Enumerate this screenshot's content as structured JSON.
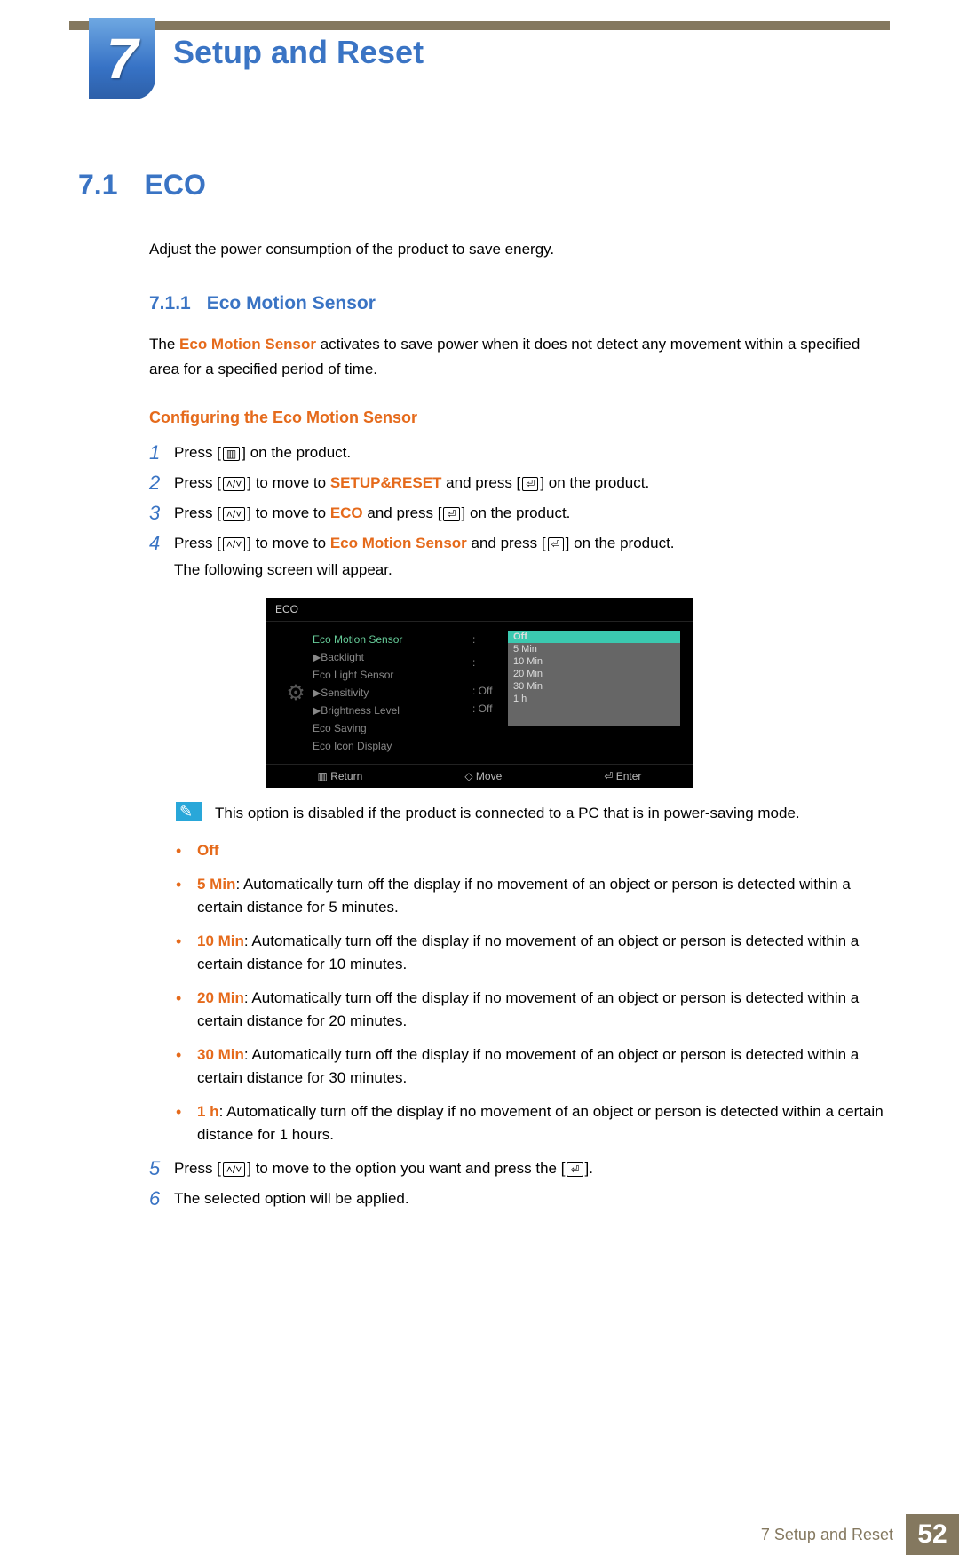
{
  "chapter": {
    "number": "7",
    "title": "Setup and Reset"
  },
  "section": {
    "number": "7.1",
    "title": "ECO",
    "intro": "Adjust the power consumption of the product to save energy."
  },
  "subsection": {
    "number": "7.1.1",
    "title": "Eco Motion Sensor",
    "desc_prefix": "The ",
    "desc_highlight": "Eco Motion Sensor",
    "desc_suffix": " activates to save power when it does not detect any movement within a specified area for a specified period of time."
  },
  "config_heading": "Configuring the Eco Motion Sensor",
  "steps": {
    "s1": {
      "n": "1",
      "a": "Press [",
      "b": "] on the product."
    },
    "s2": {
      "n": "2",
      "a": "Press [",
      "b": "] to move to ",
      "kw": "SETUP&RESET",
      "c": " and press [",
      "d": "] on the product."
    },
    "s3": {
      "n": "3",
      "a": "Press [",
      "b": "] to move to ",
      "kw": "ECO",
      "c": " and press [",
      "d": "] on the product."
    },
    "s4": {
      "n": "4",
      "a": "Press [",
      "b": "] to move to ",
      "kw": "Eco Motion Sensor",
      "c": " and press [",
      "d": "] on the product.",
      "e": "The following screen will appear."
    },
    "s5": {
      "n": "5",
      "a": "Press [",
      "b": "] to move to the option you want and press the [",
      "c": "]."
    },
    "s6": {
      "n": "6",
      "a": "The selected option will be applied."
    }
  },
  "osd": {
    "title": "ECO",
    "items": [
      "Eco Motion Sensor",
      "▶Backlight",
      "Eco Light Sensor",
      "▶Sensitivity",
      "▶Brightness Level",
      "Eco Saving",
      "Eco Icon Display"
    ],
    "values": [
      ":",
      "",
      ":",
      "",
      "",
      ": Off",
      ": Off"
    ],
    "dropdown": [
      "Off",
      "5 Min",
      "10 Min",
      "20 Min",
      "30 Min",
      "1 h"
    ],
    "footer": [
      "▥ Return",
      "◇ Move",
      "⏎ Enter"
    ]
  },
  "note": "This option is disabled if the product is connected to a PC that is in power-saving mode.",
  "options": {
    "off": "Off",
    "o5": {
      "k": "5 Min",
      "t": ": Automatically turn off the display if no movement of an object or person is detected within a certain distance for 5 minutes."
    },
    "o10": {
      "k": "10 Min",
      "t": ": Automatically turn off the display if no movement of an object or person is detected within a certain distance for 10 minutes."
    },
    "o20": {
      "k": "20 Min",
      "t": ": Automatically turn off the display if no movement of an object or person is detected within a certain distance for 20 minutes."
    },
    "o30": {
      "k": "30 Min",
      "t": ": Automatically turn off the display if no movement of an object or person is detected within a certain distance for 30 minutes."
    },
    "o1h": {
      "k": "1 h",
      "t": ": Automatically turn off the display if no movement of an object or person is detected within a certain distance for 1 hours."
    }
  },
  "footer": {
    "text": "7 Setup and Reset",
    "page": "52"
  }
}
